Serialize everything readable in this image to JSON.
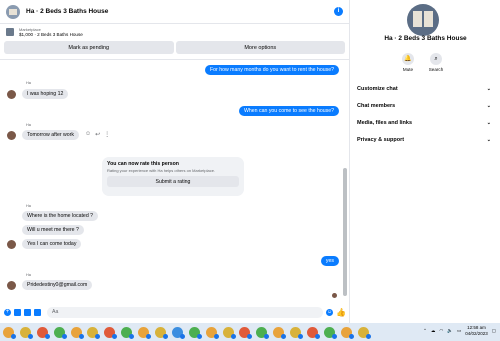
{
  "header": {
    "title": "Ha · 2 Beds 3 Baths House"
  },
  "marketplace": {
    "label": "Marketplace",
    "listing": "$1,000 · 2 Beds 3 Baths House"
  },
  "actions": {
    "pending": "Mark as pending",
    "more": "More options"
  },
  "messages": [
    {
      "dir": "out",
      "text": "For how many months do you want to rent the house?"
    },
    {
      "dir": "in",
      "sender": "Ha",
      "text": "I was hoping 12"
    },
    {
      "dir": "out",
      "text": "When can you come to see the house?"
    },
    {
      "dir": "in",
      "sender": "Ha",
      "text": "Tomorrow after work"
    },
    {
      "dir": "in",
      "sender": "Ha",
      "text": "Where is the home located ?"
    },
    {
      "dir": "in",
      "text": "Will u meet me there ?"
    },
    {
      "dir": "in",
      "text": "Yes I can come today"
    },
    {
      "dir": "out",
      "text": "yes"
    },
    {
      "dir": "in",
      "sender": "Ha",
      "text": "Pridedestiny0@gmail.com"
    }
  ],
  "rating": {
    "title": "You can now rate this person",
    "subtitle": "Rating your experience with Ha helps others on Marketplace.",
    "button": "Submit a rating"
  },
  "composer": {
    "placeholder": "Aa"
  },
  "sidebar": {
    "title": "Ha · 2 Beds 3 Baths House",
    "mute": "Mute",
    "search": "Search",
    "items": [
      "Customize chat",
      "Chat members",
      "Media, files and links",
      "Privacy & support"
    ]
  },
  "taskbar": {
    "time": "12:58 am",
    "date": "04/02/2023"
  },
  "colors": {
    "accent": "#0a7cff",
    "bubble_in": "#e4e6eb"
  }
}
